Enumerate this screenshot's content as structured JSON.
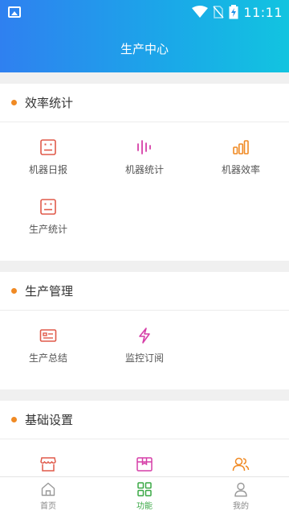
{
  "status_bar": {
    "time": "11:11"
  },
  "header": {
    "title": "生产中心"
  },
  "sections": [
    {
      "title": "效率统计",
      "items": [
        {
          "label": "机器日报",
          "icon": "report-icon",
          "color": "#e05a4a"
        },
        {
          "label": "机器统计",
          "icon": "bars-icon",
          "color": "#d63fa8"
        },
        {
          "label": "机器效率",
          "icon": "bar-chart-icon",
          "color": "#f08a24"
        },
        {
          "label": "生产统计",
          "icon": "report-icon",
          "color": "#e05a4a"
        }
      ]
    },
    {
      "title": "生产管理",
      "items": [
        {
          "label": "生产总结",
          "icon": "card-icon",
          "color": "#e05a4a"
        },
        {
          "label": "监控订阅",
          "icon": "lightning-icon",
          "color": "#d63fa8"
        }
      ]
    },
    {
      "title": "基础设置",
      "items": [
        {
          "label": "",
          "icon": "store-icon",
          "color": "#e05a4a"
        },
        {
          "label": "",
          "icon": "box-icon",
          "color": "#d63fa8"
        },
        {
          "label": "",
          "icon": "users-icon",
          "color": "#f08a24"
        }
      ]
    }
  ],
  "tabbar": {
    "tabs": [
      {
        "label": "首页",
        "icon": "home-icon"
      },
      {
        "label": "功能",
        "icon": "grid-icon",
        "active": true
      },
      {
        "label": "我的",
        "icon": "person-icon"
      }
    ],
    "active_color": "#3aa845"
  }
}
